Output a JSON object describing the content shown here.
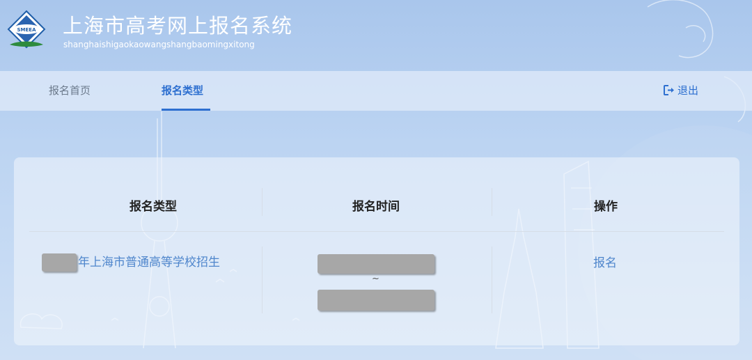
{
  "header": {
    "title": "上海市高考网上报名系统",
    "subtitle": "shanghaishigaokaowangshangbaomingxitong",
    "logo_text": "SMEEA"
  },
  "nav": {
    "items": [
      {
        "label": "报名首页",
        "active": false
      },
      {
        "label": "报名类型",
        "active": true
      }
    ],
    "logout_label": "退出",
    "logout_icon": "logout-icon"
  },
  "table": {
    "columns": [
      "报名类型",
      "报名时间",
      "操作"
    ],
    "rows": [
      {
        "type": "年上海市普通高等学校招生",
        "time_separator": "~",
        "action": "报名"
      }
    ]
  },
  "colors": {
    "accent": "#2d6fd0",
    "link": "#4f86cc",
    "background": "#bcd4f2"
  }
}
